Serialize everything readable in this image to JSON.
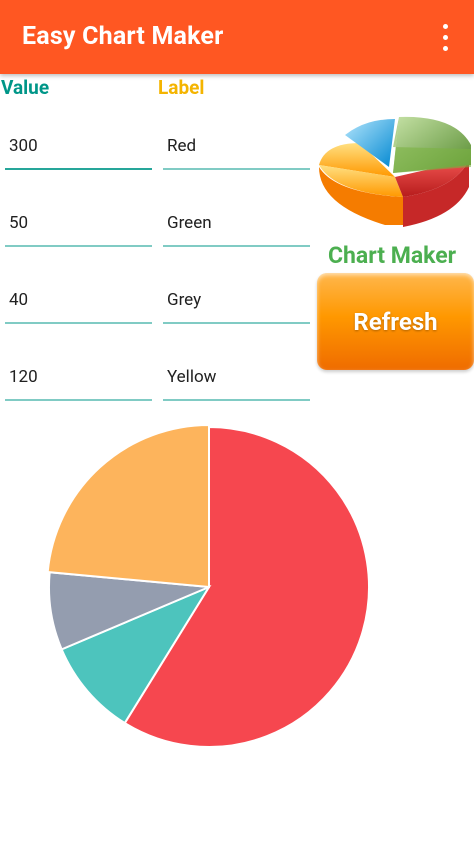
{
  "app": {
    "title": "Easy Chart Maker"
  },
  "columns": {
    "value_header": "Value",
    "label_header": "Label"
  },
  "rows": [
    {
      "value": "300",
      "label": "Red"
    },
    {
      "value": "50",
      "label": "Green"
    },
    {
      "value": "40",
      "label": "Grey"
    },
    {
      "value": "120",
      "label": "Yellow"
    }
  ],
  "brand": {
    "text": "Chart Maker"
  },
  "refresh_button": {
    "label": "Refresh"
  },
  "icons": {
    "overflow": "overflow-menu-icon",
    "logo": "3d-pie-chart-logo-icon"
  },
  "chart_data": {
    "type": "pie",
    "categories": [
      "Red",
      "Green",
      "Grey",
      "Yellow"
    ],
    "values": [
      300,
      50,
      40,
      120
    ],
    "colors": [
      "#f6474f",
      "#4dc4bd",
      "#949daf",
      "#fdb45c"
    ]
  }
}
